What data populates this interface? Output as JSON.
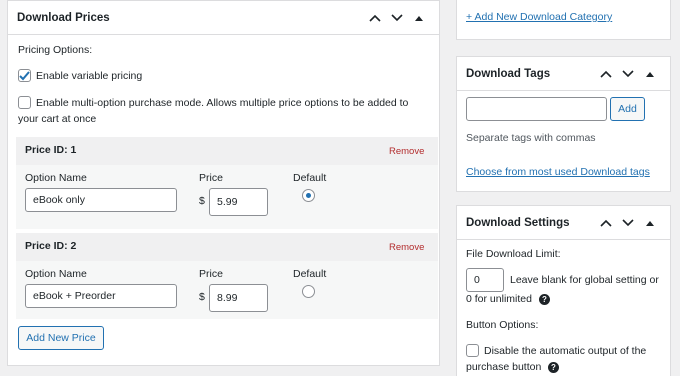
{
  "prices_box": {
    "title": "Download Prices",
    "pricing_options_label": "Pricing Options:",
    "enable_variable_pricing": "Enable variable pricing",
    "multi_option_line1": "Enable multi-option purchase mode. Allows multiple price options to be added to",
    "multi_option_line2": "your cart at once",
    "rows": [
      {
        "header": "Price ID: 1",
        "remove": "Remove",
        "option_name_label": "Option Name",
        "option_name": "eBook only",
        "price_label": "Price",
        "currency": "$",
        "price": "5.99",
        "default_label": "Default",
        "is_default": true
      },
      {
        "header": "Price ID: 2",
        "remove": "Remove",
        "option_name_label": "Option Name",
        "option_name": "eBook + Preorder",
        "price_label": "Price",
        "currency": "$",
        "price": "8.99",
        "default_label": "Default",
        "is_default": false
      }
    ],
    "add_new_price": "Add New Price"
  },
  "categories_box": {
    "add_new_category": "+ Add New Download Category"
  },
  "tags_box": {
    "title": "Download Tags",
    "add_button": "Add",
    "separate_hint": "Separate tags with commas",
    "choose_link": "Choose from most used Download tags"
  },
  "settings_box": {
    "title": "Download Settings",
    "file_limit_label": "File Download Limit:",
    "file_limit_value": "0",
    "leave_blank_line1": "Leave blank for global setting or",
    "leave_blank_line2": "0 for unlimited",
    "button_options_label": "Button Options:",
    "disable_output_line1": "Disable the automatic output of the",
    "disable_output_line2": "purchase button"
  },
  "icons": {
    "collapse_up": "chevron-up-icon",
    "collapse_down": "chevron-down-icon",
    "toggle": "triangle-up-icon",
    "check": "checkmark-icon",
    "help": "help-icon"
  }
}
